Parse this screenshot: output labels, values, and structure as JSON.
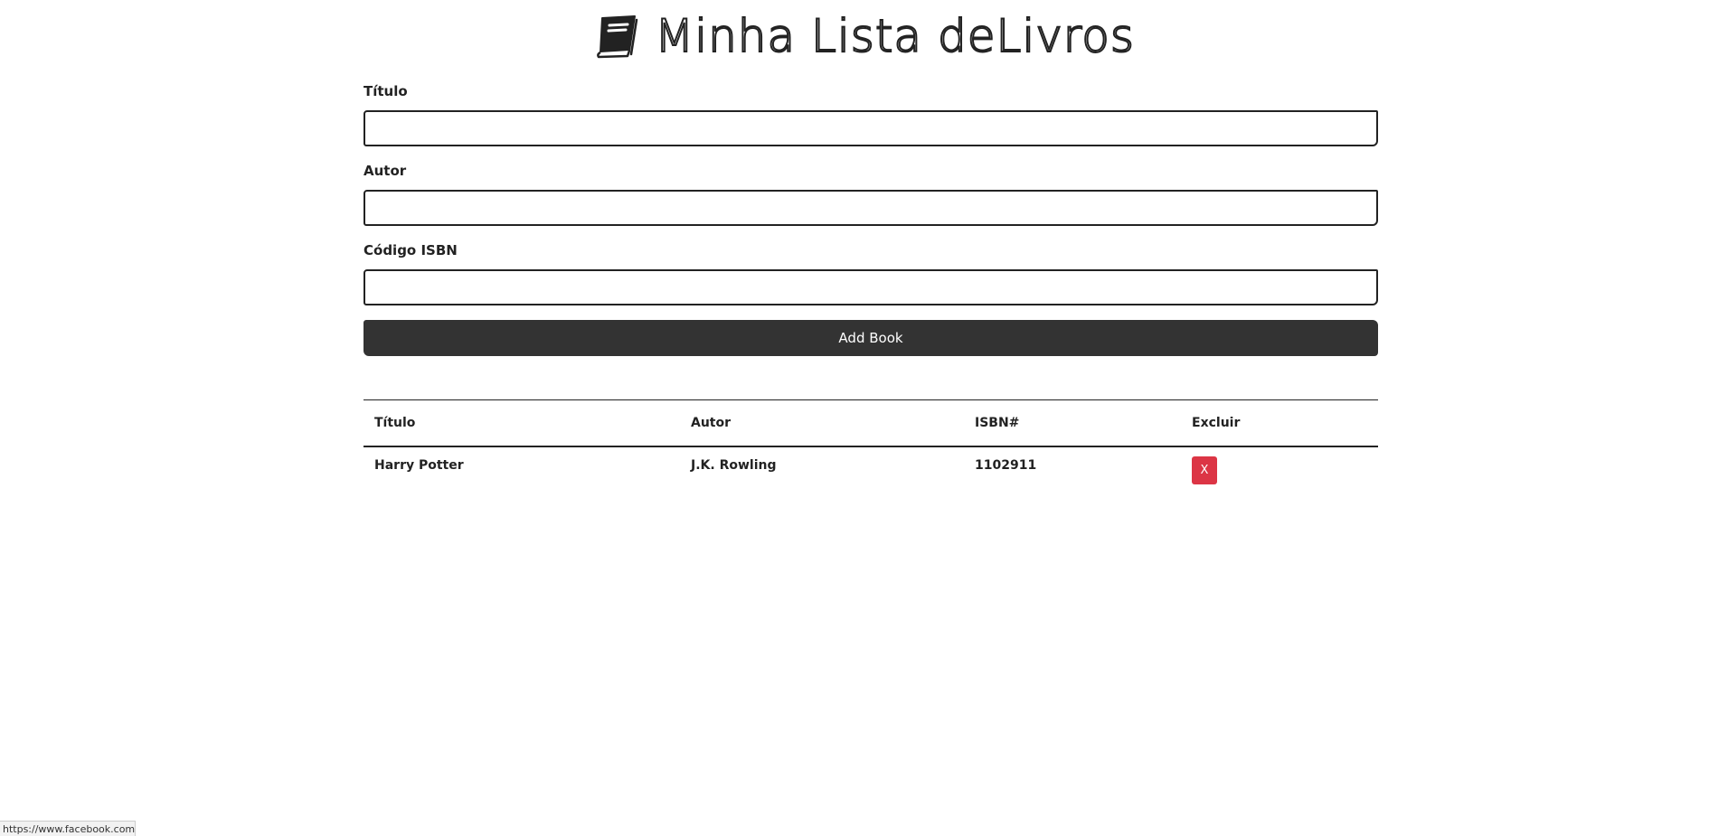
{
  "header": {
    "title": "Minha Lista deLivros",
    "icon": "book-icon"
  },
  "form": {
    "title_label": "Título",
    "title_value": "",
    "author_label": "Autor",
    "author_value": "",
    "isbn_label": "Código ISBN",
    "isbn_value": "",
    "submit_label": "Add Book"
  },
  "table": {
    "headers": [
      "Título",
      "Autor",
      "ISBN#",
      "Excluir"
    ],
    "rows": [
      {
        "title": "Harry Potter",
        "author": "J.K. Rowling",
        "isbn": "1102911",
        "delete_label": "X"
      }
    ]
  },
  "status_bar": {
    "url": "https://www.facebook.com"
  },
  "colors": {
    "button_dark": "#333333",
    "delete_red": "#dc3545",
    "text": "#222222"
  }
}
